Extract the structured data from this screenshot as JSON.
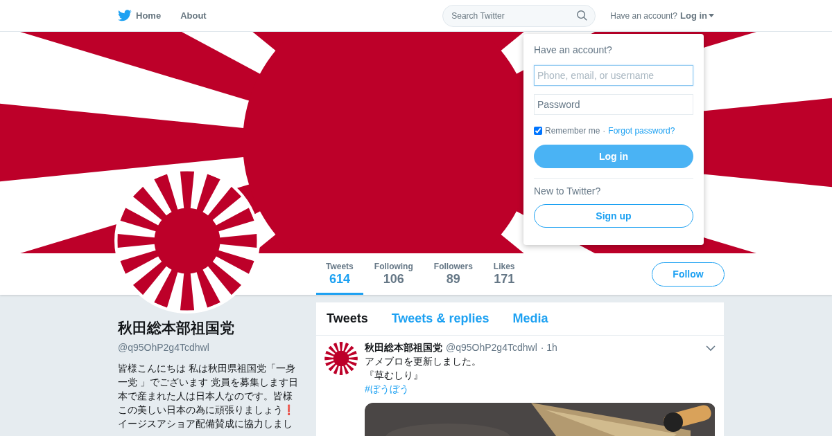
{
  "nav": {
    "items": [
      {
        "label": "Home"
      },
      {
        "label": "About"
      }
    ],
    "search": {
      "placeholder": "Search Twitter"
    },
    "account_prompt": "Have an account?",
    "login_link": "Log in"
  },
  "login_dropdown": {
    "title": "Have an account?",
    "username": {
      "placeholder": "Phone, email, or username"
    },
    "password": {
      "placeholder": "Password"
    },
    "remember": {
      "label": "Remember me",
      "checked": true
    },
    "separator": "·",
    "forgot": "Forgot password?",
    "login_button": "Log in",
    "new_prompt": "New to Twitter?",
    "signup_button": "Sign up"
  },
  "stats": [
    {
      "label": "Tweets",
      "value": "614",
      "selected": true
    },
    {
      "label": "Following",
      "value": "106",
      "selected": false
    },
    {
      "label": "Followers",
      "value": "89",
      "selected": false
    },
    {
      "label": "Likes",
      "value": "171",
      "selected": false
    }
  ],
  "follow_button": "Follow",
  "profile": {
    "name": "秋田総本部祖国党",
    "handle": "@q95OhP2g4Tcdhwl",
    "bio": "皆様こんにちは 私は秋田県祖国党「一身一党 」でございます 党員を募集します日本で産まれた人は日本人なのです。皆様この美しい日本の為に頑張りましょう❗イージスアショア配備賛成に協力しまし"
  },
  "timeline_tabs": [
    {
      "label": "Tweets",
      "selected": true
    },
    {
      "label": "Tweets & replies",
      "selected": false
    },
    {
      "label": "Media",
      "selected": false
    }
  ],
  "tweets": [
    {
      "name": "秋田総本部祖国党",
      "handle": "@q95OhP2g4Tcdhwl",
      "time": "· 1h",
      "lines": [
        "アメブロを更新しました。",
        "『草むしり』"
      ],
      "hashtag": "#ぼうぼう",
      "media": {
        "kind": "picture"
      }
    }
  ]
}
